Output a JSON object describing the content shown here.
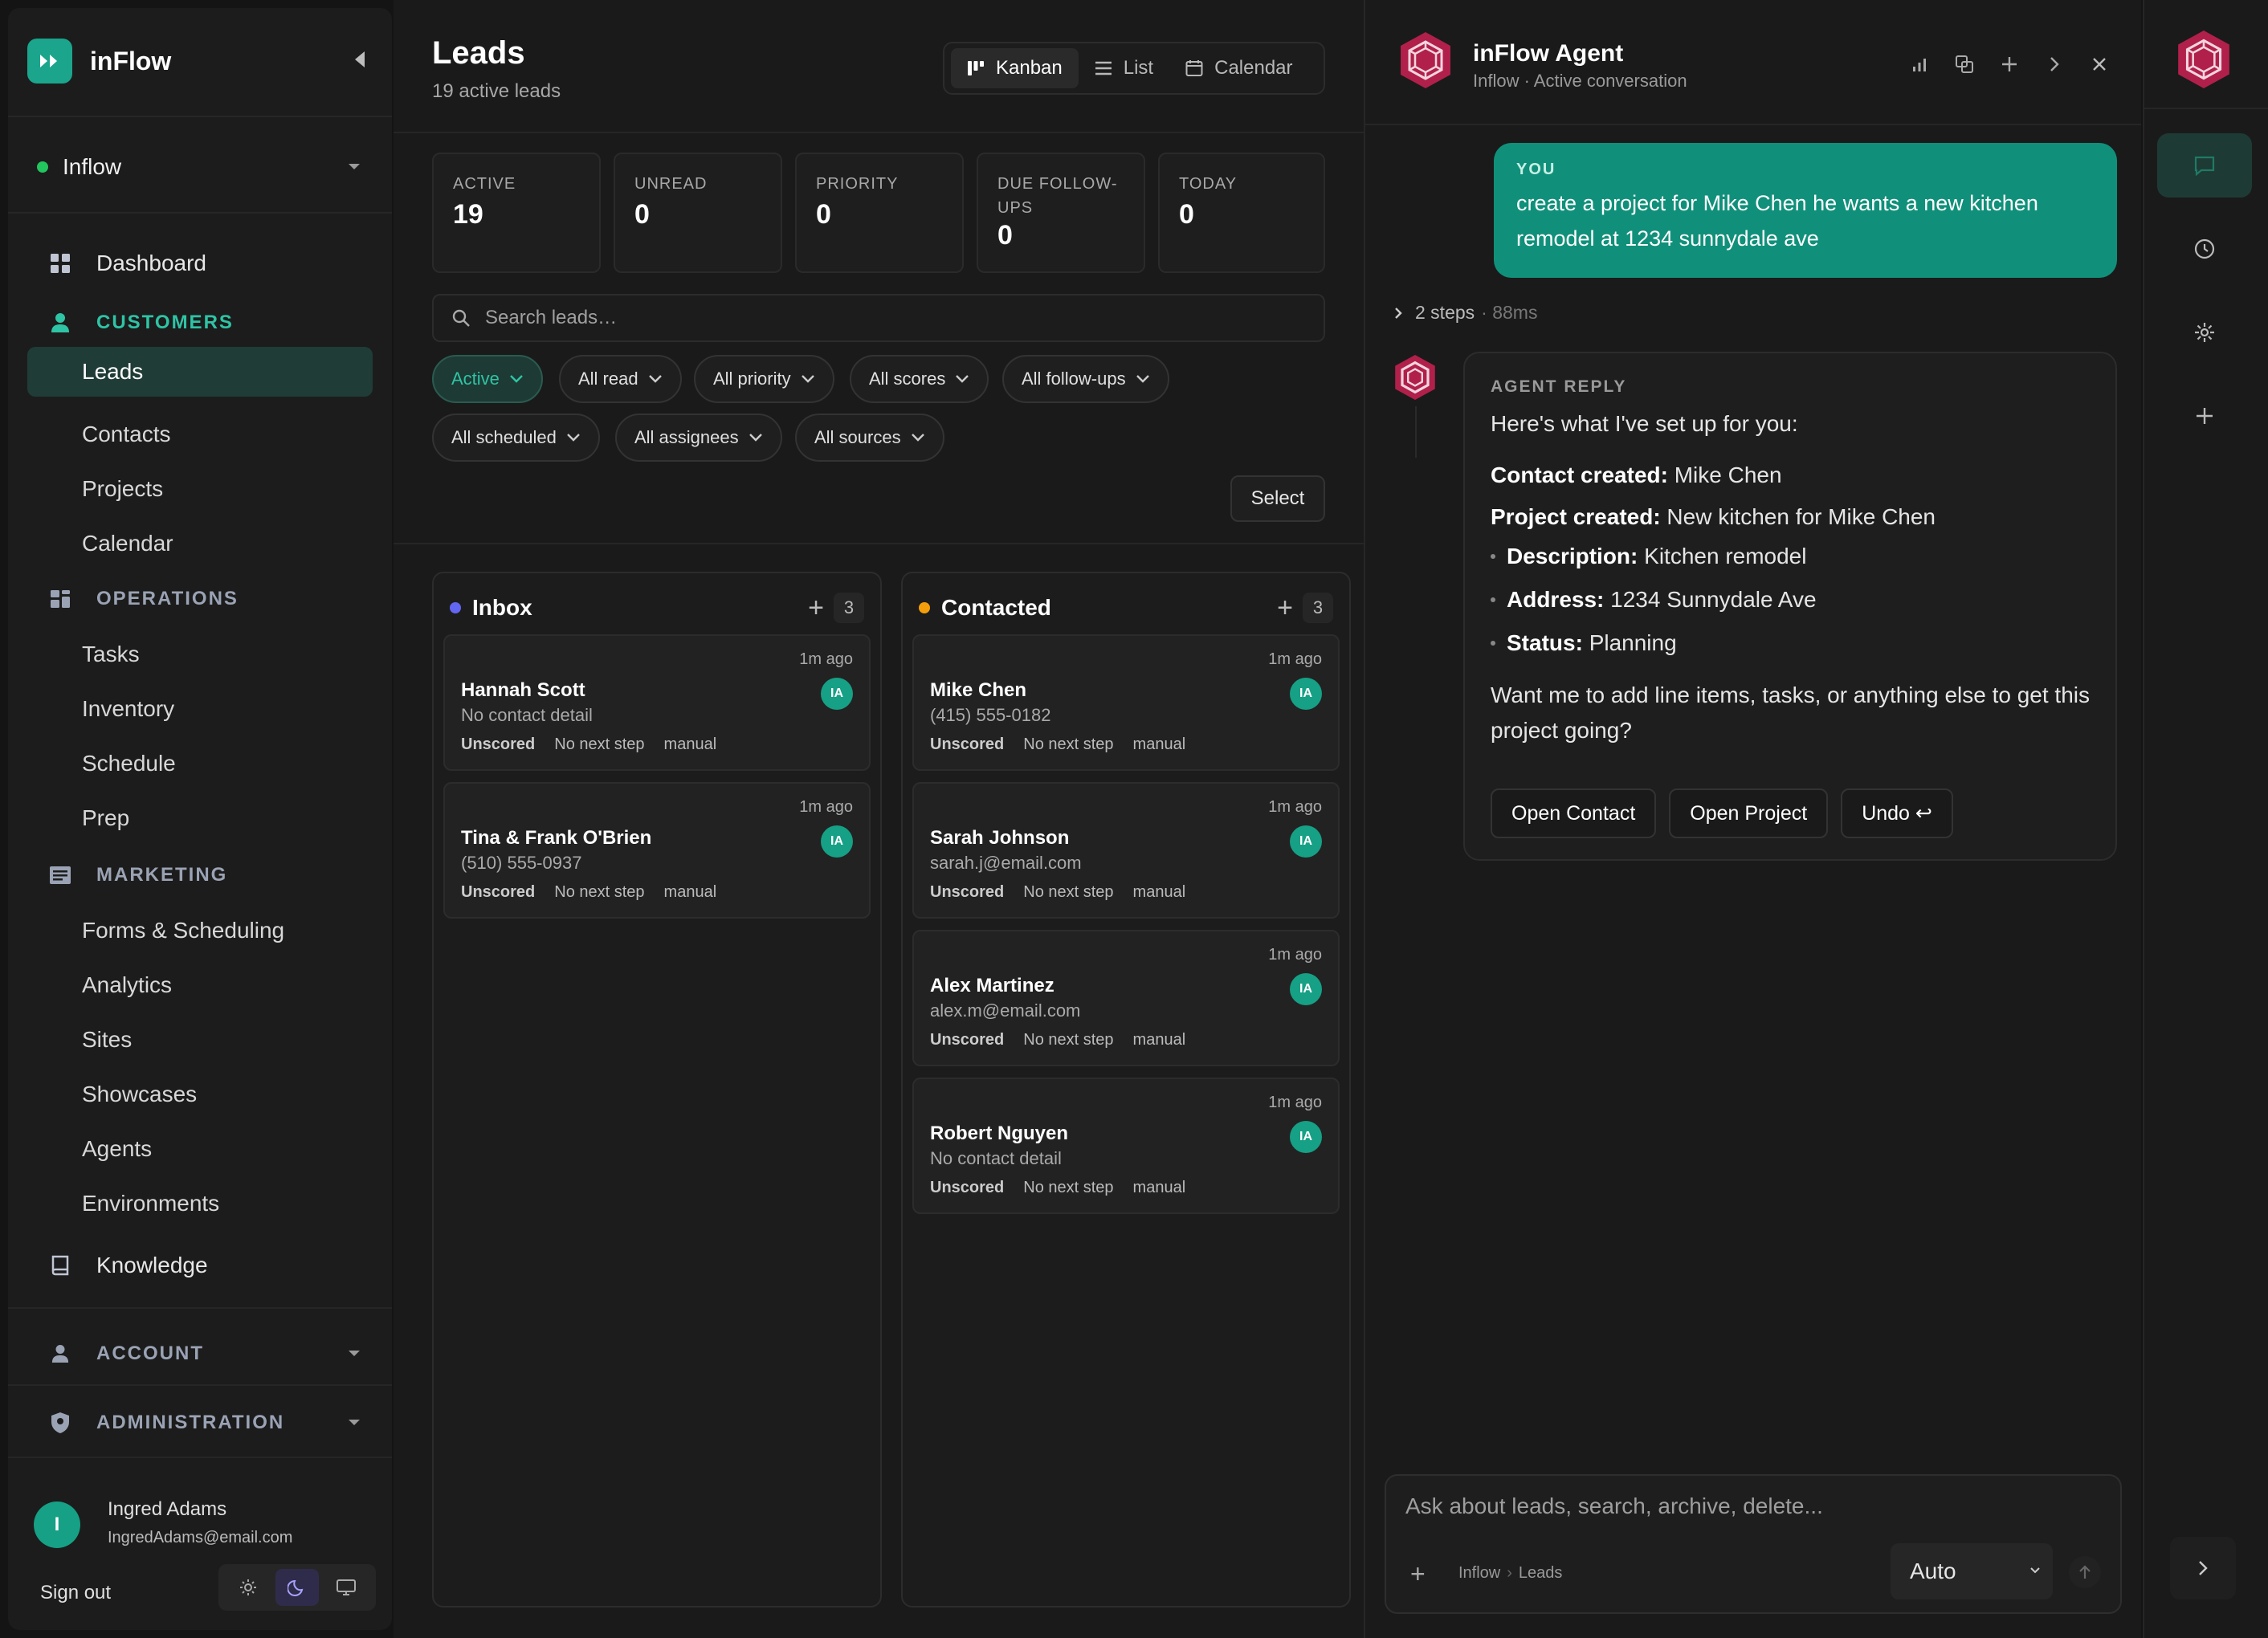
{
  "colors": {
    "accent": "#1aa58c",
    "inbox_dot": "#6366f1",
    "contacted_dot": "#f59e0b",
    "online": "#22c55e"
  },
  "sidebar": {
    "brand": "inFlow",
    "workspace": "Inflow",
    "dashboard": "Dashboard",
    "sections": {
      "customers": {
        "label": "CUSTOMERS",
        "items": [
          "Leads",
          "Contacts",
          "Projects",
          "Calendar"
        ]
      },
      "operations": {
        "label": "OPERATIONS",
        "items": [
          "Tasks",
          "Inventory",
          "Schedule",
          "Prep"
        ]
      },
      "marketing": {
        "label": "MARKETING",
        "items": [
          "Forms & Scheduling",
          "Analytics",
          "Sites",
          "Showcases",
          "Agents",
          "Environments"
        ]
      }
    },
    "knowledge": "Knowledge",
    "account": "ACCOUNT",
    "administration": "ADMINISTRATION",
    "user": {
      "initial": "I",
      "name": "Ingred Adams",
      "email": "IngredAdams@email.com"
    },
    "sign_out": "Sign out"
  },
  "leads": {
    "title": "Leads",
    "subtitle": "19 active leads",
    "views": [
      "Kanban",
      "List",
      "Calendar"
    ],
    "stats": [
      {
        "label": "ACTIVE",
        "value": "19"
      },
      {
        "label": "UNREAD",
        "value": "0"
      },
      {
        "label": "PRIORITY",
        "value": "0"
      },
      {
        "label": "DUE FOLLOW-UPS",
        "value": "0"
      },
      {
        "label": "TODAY",
        "value": "0"
      }
    ],
    "search_placeholder": "Search leads…",
    "filters": [
      "Active",
      "All read",
      "All priority",
      "All scores",
      "All follow-ups",
      "All scheduled",
      "All assignees",
      "All sources"
    ],
    "select_label": "Select",
    "columns": [
      {
        "title": "Inbox",
        "count": "3",
        "cards": [
          {
            "time": "1m ago",
            "name": "Hannah Scott",
            "contact": "No contact detail",
            "initials": "IA",
            "score": "Unscored",
            "next": "No next step",
            "source": "manual"
          },
          {
            "time": "1m ago",
            "name": "Tina & Frank O'Brien",
            "contact": "(510) 555-0937",
            "initials": "IA",
            "score": "Unscored",
            "next": "No next step",
            "source": "manual"
          }
        ]
      },
      {
        "title": "Contacted",
        "count": "3",
        "cards": [
          {
            "time": "1m ago",
            "name": "Mike Chen",
            "contact": "(415) 555-0182",
            "initials": "IA",
            "score": "Unscored",
            "next": "No next step",
            "source": "manual"
          },
          {
            "time": "1m ago",
            "name": "Sarah Johnson",
            "contact": "sarah.j@email.com",
            "initials": "IA",
            "score": "Unscored",
            "next": "No next step",
            "source": "manual"
          },
          {
            "time": "1m ago",
            "name": "Alex Martinez",
            "contact": "alex.m@email.com",
            "initials": "IA",
            "score": "Unscored",
            "next": "No next step",
            "source": "manual"
          },
          {
            "time": "1m ago",
            "name": "Robert Nguyen",
            "contact": "No contact detail",
            "initials": "IA",
            "score": "Unscored",
            "next": "No next step",
            "source": "manual"
          }
        ]
      }
    ]
  },
  "agent": {
    "title": "inFlow Agent",
    "subtitle": "Inflow · Active conversation",
    "user_label": "YOU",
    "user_message": "create a project for Mike Chen he wants a new kitchen remodel at 1234 sunnydale ave",
    "steps": "2 steps",
    "steps_time": "· 88ms",
    "reply_label": "AGENT REPLY",
    "intro": "Here's what I've set up for you:",
    "contact_label": "Contact created:",
    "contact_value": "Mike Chen",
    "project_label": "Project created:",
    "project_value": "New kitchen for Mike Chen",
    "bullets": [
      {
        "label": "Description:",
        "value": "Kitchen remodel"
      },
      {
        "label": "Address:",
        "value": "1234 Sunnydale Ave"
      },
      {
        "label": "Status:",
        "value": "Planning"
      }
    ],
    "question": "Want me to add line items, tasks, or anything else to get this project going?",
    "buttons": [
      "Open Contact",
      "Open Project",
      "Undo ↩"
    ],
    "composer_placeholder": "Ask about leads, search, archive, delete...",
    "crumb": [
      "Inflow",
      "Leads"
    ],
    "mode": "Auto"
  }
}
